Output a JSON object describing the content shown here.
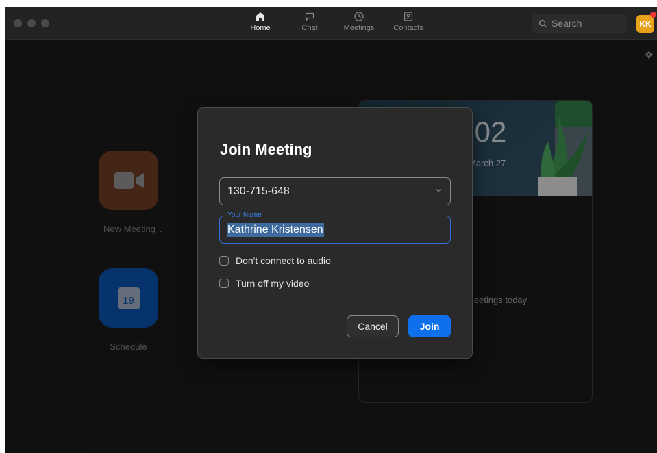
{
  "nav": {
    "tabs": [
      {
        "label": "Home",
        "icon": "home-icon",
        "active": true
      },
      {
        "label": "Chat",
        "icon": "chat-icon",
        "active": false
      },
      {
        "label": "Meetings",
        "icon": "clock-icon",
        "active": false
      },
      {
        "label": "Contacts",
        "icon": "contacts-icon",
        "active": false
      }
    ],
    "search_placeholder": "Search",
    "avatar_initials": "KK"
  },
  "home": {
    "new_meeting_label": "New Meeting",
    "schedule_label": "Schedule",
    "calendar_day": "19",
    "clock_partial": ".02",
    "date_partial": "March 27",
    "no_meetings_partial": "meetings today"
  },
  "dialog": {
    "title": "Join Meeting",
    "meeting_id": "130-715-648",
    "name_label": "Your Name",
    "name_value": "Kathrine Kristensen",
    "options": [
      {
        "label": "Don't connect to audio",
        "checked": false
      },
      {
        "label": "Turn off my video",
        "checked": false
      }
    ],
    "cancel_label": "Cancel",
    "join_label": "Join"
  },
  "colors": {
    "accent": "#0e71eb",
    "new_meeting_tile": "#e0702f",
    "schedule_tile": "#0e71eb",
    "avatar": "#e8a21a",
    "notification": "#e9383a"
  }
}
